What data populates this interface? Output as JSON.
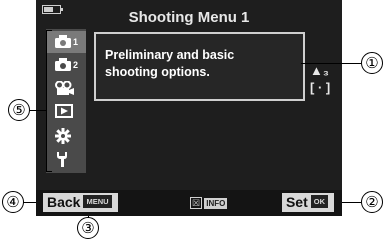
{
  "menu": {
    "title": "Shooting Menu 1"
  },
  "sidebar": {
    "tabs": [
      {
        "icon": "camera-1-icon",
        "num": "1",
        "active": true
      },
      {
        "icon": "camera-2-icon",
        "num": "2"
      },
      {
        "icon": "video-icon"
      },
      {
        "icon": "playback-icon"
      },
      {
        "icon": "gear-icon"
      },
      {
        "icon": "wrench-icon"
      }
    ]
  },
  "content": {
    "description": "Preliminary and basic\nshooting options."
  },
  "right_icons": [
    "▲₃",
    "[ · ]"
  ],
  "bottom": {
    "back_label": "Back",
    "back_tag": "MENU",
    "info_symbol": "☒",
    "info_tag": "INFO",
    "set_label": "Set",
    "set_tag": "OK"
  },
  "callouts": [
    "①",
    "②",
    "③",
    "④",
    "⑤"
  ]
}
